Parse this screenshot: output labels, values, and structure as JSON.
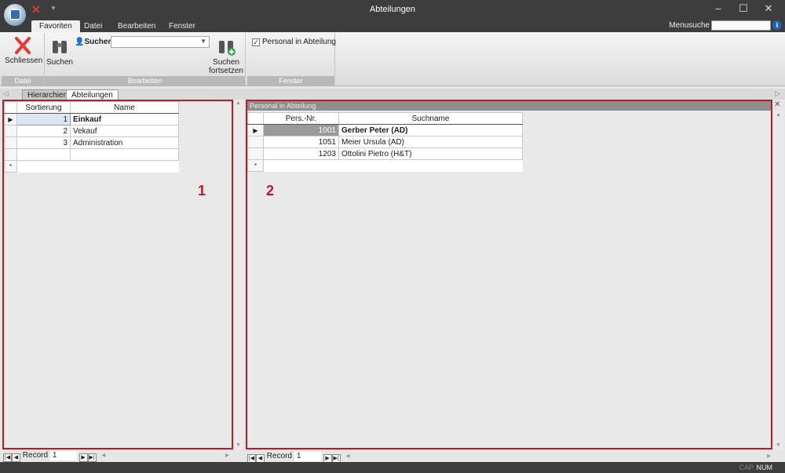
{
  "window": {
    "title": "Abteilungen"
  },
  "window_controls": {
    "minimize": "–",
    "maximize": "☐",
    "close": "✕"
  },
  "ribbon_tabs": [
    "Favoriten",
    "Datei",
    "Bearbeiten",
    "Fenster"
  ],
  "menusuche": {
    "label": "Menusuche",
    "value": ""
  },
  "help_icon": "i",
  "groups": {
    "datei": {
      "label": "Datei",
      "close_label": "Schliessen"
    },
    "bearbeiten": {
      "label": "Bearbeiten",
      "search_label": "Suchen",
      "small_search_label": "Suchen",
      "search_value": "",
      "continue_label_1": "Suchen",
      "continue_label_2": "fortsetzen"
    },
    "fenster": {
      "label": "Fenster",
      "checkbox_label": "Personal in Abteilung",
      "checked": true
    }
  },
  "doc_tabs": [
    "Hierarchien",
    "Abteilungen"
  ],
  "left_grid": {
    "columns": [
      "Sortierung",
      "Name"
    ],
    "rows": [
      {
        "sort": "1",
        "name": "Einkauf"
      },
      {
        "sort": "2",
        "name": "Vekauf"
      },
      {
        "sort": "3",
        "name": "Administration"
      }
    ],
    "new_row_marker": "*",
    "current_row_marker": "▶"
  },
  "right_pane": {
    "header": "Personal in Abteilung",
    "columns": [
      "Pers.-Nr.",
      "Suchname"
    ],
    "rows": [
      {
        "nr": "1001",
        "name": "Gerber Peter (AD)"
      },
      {
        "nr": "1051",
        "name": "Meier Ursula (AD)"
      },
      {
        "nr": "1203",
        "name": "Ottolini Pietro (H&T)"
      }
    ],
    "new_row_marker": "*",
    "current_row_marker": "▶"
  },
  "annotations": {
    "left": "1",
    "right": "2"
  },
  "record_nav": {
    "label": "Record",
    "left_value": "1",
    "right_value": "1"
  },
  "statusbar": {
    "cap": "CAP",
    "num": "NUM"
  },
  "colors": {
    "annotation_border": "#b71c2b",
    "titlebar": "#3d3d3d",
    "help_blue": "#1e63b5"
  }
}
